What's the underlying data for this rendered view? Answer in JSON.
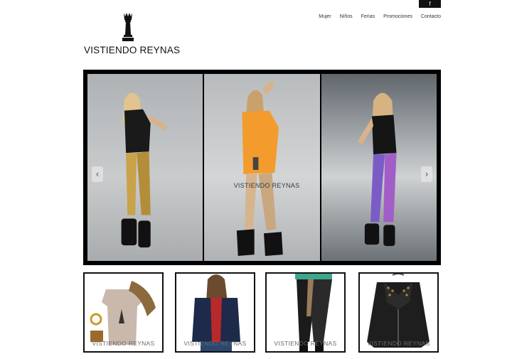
{
  "social": {
    "facebook_label": "f"
  },
  "brand": {
    "name": "VISTIENDO REYNAS"
  },
  "nav": {
    "items": [
      "Mujer",
      "Niños",
      "Ferias",
      "Promociones",
      "Contacto"
    ]
  },
  "slider": {
    "watermark": "VISTIENDO REYNAS",
    "prev_label": "‹",
    "next_label": "›"
  },
  "thumbnails": [
    {
      "watermark": "VISTIENDO REYNAS"
    },
    {
      "watermark": "VISTIENDO REYNAS"
    },
    {
      "watermark": "VISTIENDO REYNAS"
    },
    {
      "watermark": "VISTIENDO REYNAS"
    }
  ],
  "colors": {
    "accent": "#000000",
    "background": "#ffffff"
  }
}
